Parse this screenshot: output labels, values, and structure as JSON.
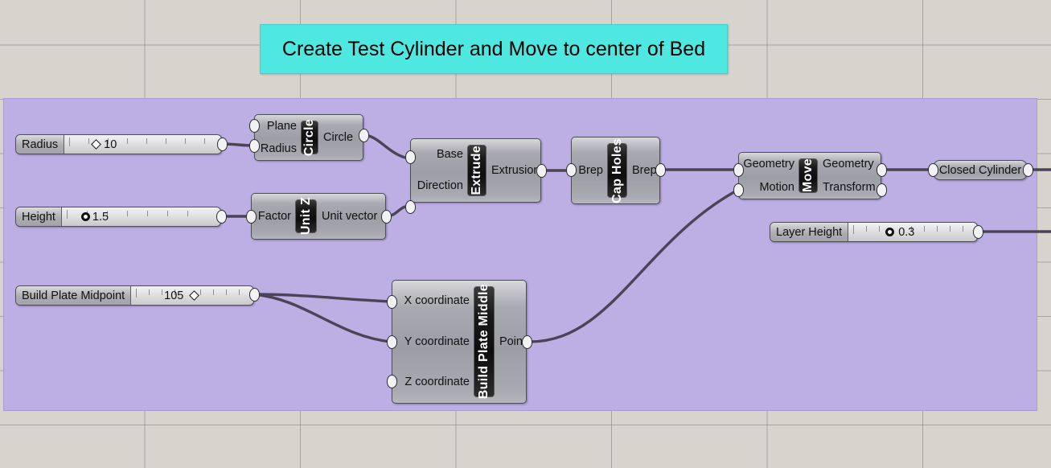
{
  "canvas": {
    "background_color": "#d7d3cd",
    "grid_color": "#6e6964"
  },
  "group": {
    "name": "definition-group",
    "color": "#bdaee4"
  },
  "title_banner": {
    "text": "Create Test Cylinder and Move to center of Bed",
    "color": "#4fe8e0"
  },
  "sliders": [
    {
      "name": "Radius",
      "value": "10",
      "knob": "diamond",
      "knob_pct": 20,
      "value_side": "right"
    },
    {
      "name": "Height",
      "value": "1.5",
      "knob": "circle",
      "knob_pct": 16,
      "value_side": "right"
    },
    {
      "name": "Build Plate Midpoint",
      "value": "105",
      "knob": "diamond",
      "knob_pct": 52,
      "value_side": "left"
    },
    {
      "name": "Layer Height",
      "value": "0.3",
      "knob": "circle",
      "knob_pct": 30,
      "value_side": "right"
    }
  ],
  "components": [
    {
      "name": "Circle",
      "inputs": [
        "Plane",
        "Radius"
      ],
      "outputs": [
        "Circle"
      ]
    },
    {
      "name": "Extrude",
      "inputs": [
        "Base",
        "Direction"
      ],
      "outputs": [
        "Extrusion"
      ]
    },
    {
      "name": "Unit Z",
      "inputs": [
        "Factor"
      ],
      "outputs": [
        "Unit vector"
      ]
    },
    {
      "name": "Cap Holes",
      "inputs": [
        "Brep"
      ],
      "outputs": [
        "Brep"
      ]
    },
    {
      "name": "Move",
      "inputs": [
        "Geometry",
        "Motion"
      ],
      "outputs": [
        "Geometry",
        "Transform"
      ]
    },
    {
      "name": "Build Plate Middle",
      "inputs": [
        "X coordinate",
        "Y coordinate",
        "Z coordinate"
      ],
      "outputs": [
        "Point"
      ]
    }
  ],
  "parameters": [
    {
      "name": "Closed Cylinder"
    }
  ],
  "wire_color": "#4b4456"
}
